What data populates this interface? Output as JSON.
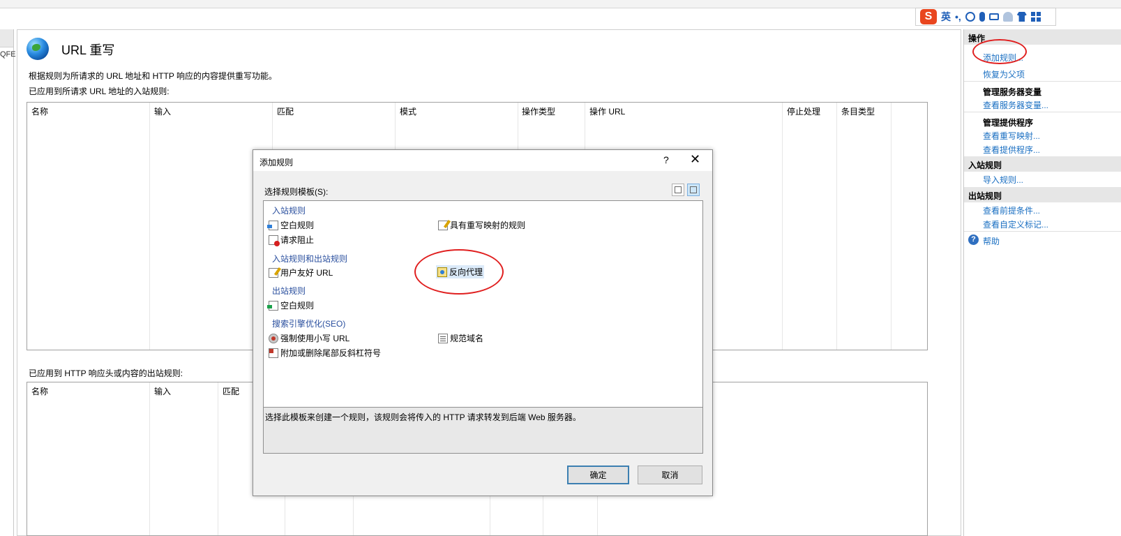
{
  "ime": {
    "logo": "S",
    "lang": "英",
    "punct": "•,"
  },
  "left": {
    "cut_text": "QFE"
  },
  "main": {
    "title": "URL 重写",
    "description": "根据规则为所请求的 URL 地址和 HTTP 响应的内容提供重写功能。",
    "inbound_label": "已应用到所请求 URL 地址的入站规则:",
    "outbound_label": "已应用到 HTTP 响应头或内容的出站规则:",
    "inbound_columns": [
      "名称",
      "输入",
      "匹配",
      "模式",
      "操作类型",
      "操作 URL",
      "停止处理",
      "条目类型"
    ],
    "outbound_columns": [
      "名称",
      "输入",
      "匹配"
    ]
  },
  "actions": {
    "header": "操作",
    "add_rule": "添加规则...",
    "revert_parent": "恢复为父项",
    "server_vars_title": "管理服务器变量",
    "view_server_vars": "查看服务器变量...",
    "providers_title": "管理提供程序",
    "view_rewrite_maps": "查看重写映射...",
    "view_providers": "查看提供程序...",
    "inbound_header": "入站规则",
    "import_rules": "导入规则...",
    "outbound_header": "出站规则",
    "view_preconditions": "查看前提条件...",
    "view_custom_tags": "查看自定义标记...",
    "help": "帮助"
  },
  "dialog": {
    "title": "添加规则",
    "help": "?",
    "close": "✕",
    "template_label": "选择规则模板(S):",
    "groups": {
      "inbound": "入站规则",
      "inbound_outbound": "入站规则和出站规则",
      "outbound": "出站规则",
      "seo": "搜索引擎优化(SEO)"
    },
    "items": {
      "blank_inbound": "空白规则",
      "rewrite_map": "具有重写映射的规则",
      "request_block": "请求阻止",
      "friendly_url": "用户友好 URL",
      "reverse_proxy": "反向代理",
      "blank_outbound": "空白规则",
      "lowercase_url": "强制使用小写 URL",
      "canonical_domain": "规范域名",
      "trailing_slash": "附加或删除尾部反斜杠符号"
    },
    "selected_item": "反向代理",
    "description": "选择此模板来创建一个规则，该规则会将传入的 HTTP 请求转发到后端 Web 服务器。",
    "ok": "确定",
    "cancel": "取消"
  },
  "colors": {
    "link": "#1a6fc2",
    "annotation": "#e01f1f",
    "group": "#2a4f9e"
  }
}
